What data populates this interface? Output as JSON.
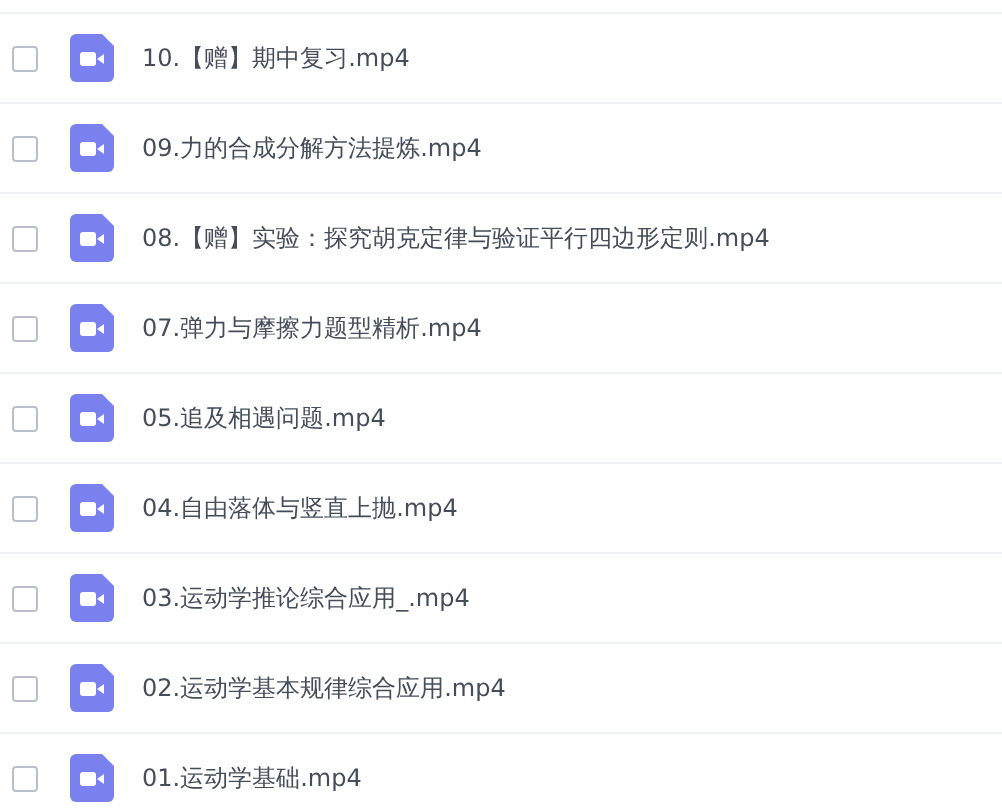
{
  "files": [
    {
      "name": "10.【赠】期中复习.mp4",
      "checked": false
    },
    {
      "name": "09.力的合成分解方法提炼.mp4",
      "checked": false
    },
    {
      "name": "08.【赠】实验：探究胡克定律与验证平行四边形定则.mp4",
      "checked": false
    },
    {
      "name": "07.弹力与摩擦力题型精析.mp4",
      "checked": false
    },
    {
      "name": "05.追及相遇问题.mp4",
      "checked": false
    },
    {
      "name": "04.自由落体与竖直上抛.mp4",
      "checked": false
    },
    {
      "name": "03.运动学推论综合应用_.mp4",
      "checked": false
    },
    {
      "name": "02.运动学基本规律综合应用.mp4",
      "checked": false
    },
    {
      "name": "01.运动学基础.mp4",
      "checked": false
    }
  ]
}
